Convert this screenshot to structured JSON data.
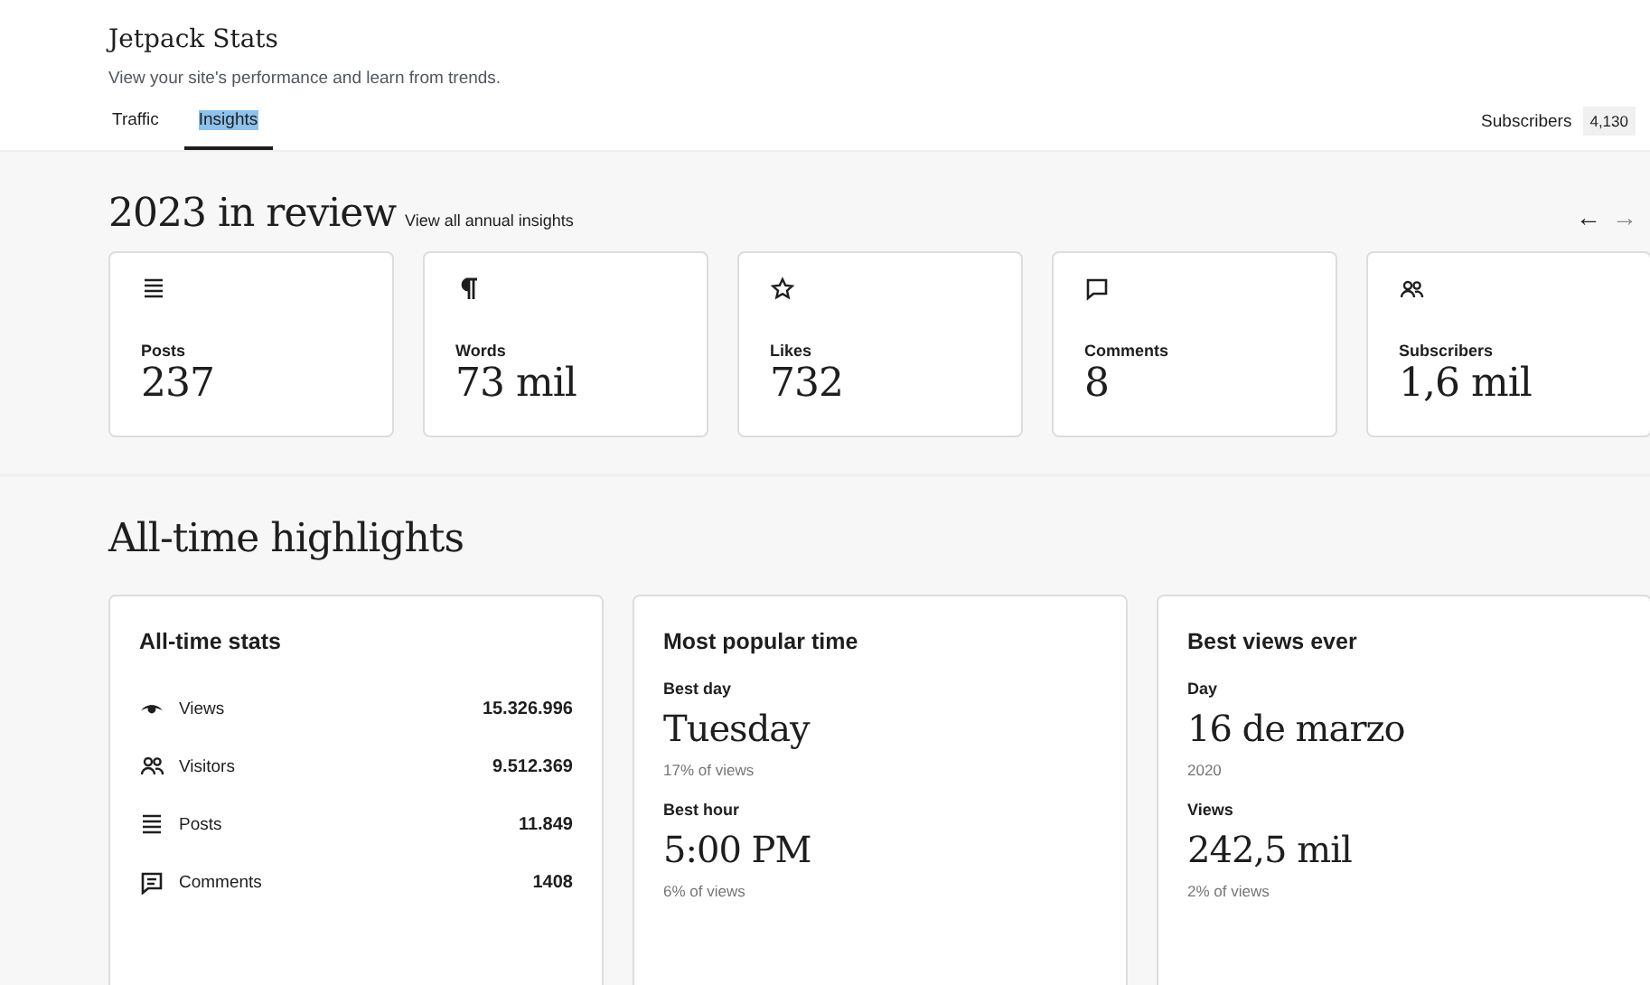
{
  "header": {
    "title": "Jetpack Stats",
    "subtitle": "View your site's performance and learn from trends."
  },
  "tabs": [
    {
      "label": "Traffic",
      "selected": false,
      "highlighted": false
    },
    {
      "label": "Insights",
      "selected": true,
      "highlighted": true
    }
  ],
  "subscribers": {
    "label": "Subscribers",
    "count": "4,130"
  },
  "review": {
    "title": "2023 in review",
    "link": "View all annual insights",
    "prev_arrow": "←",
    "next_arrow": "→",
    "next_disabled": true,
    "cards": [
      {
        "kind": "posts",
        "label": "Posts",
        "value": "237"
      },
      {
        "kind": "words",
        "label": "Words",
        "value": "73 mil"
      },
      {
        "kind": "likes",
        "label": "Likes",
        "value": "732"
      },
      {
        "kind": "comments",
        "label": "Comments",
        "value": "8"
      },
      {
        "kind": "subscribers",
        "label": "Subscribers",
        "value": "1,6 mil"
      }
    ]
  },
  "highlights": {
    "title": "All-time highlights",
    "all_time_stats": {
      "title": "All-time stats",
      "rows": [
        {
          "kind": "views",
          "label": "Views",
          "value": "15.326.996"
        },
        {
          "kind": "visitors",
          "label": "Visitors",
          "value": "9.512.369"
        },
        {
          "kind": "posts",
          "label": "Posts",
          "value": "11.849"
        },
        {
          "kind": "comments",
          "label": "Comments",
          "value": "1408"
        }
      ]
    },
    "popular_time": {
      "title": "Most popular time",
      "items": [
        {
          "label": "Best day",
          "value": "Tuesday",
          "note": "17% of views"
        },
        {
          "label": "Best hour",
          "value": "5:00 PM",
          "note": "6% of views"
        }
      ]
    },
    "best_views": {
      "title": "Best views ever",
      "items": [
        {
          "label": "Day",
          "value": "16 de marzo",
          "note": "2020"
        },
        {
          "label": "Views",
          "value": "242,5 mil",
          "note": "2% of views"
        }
      ]
    }
  }
}
